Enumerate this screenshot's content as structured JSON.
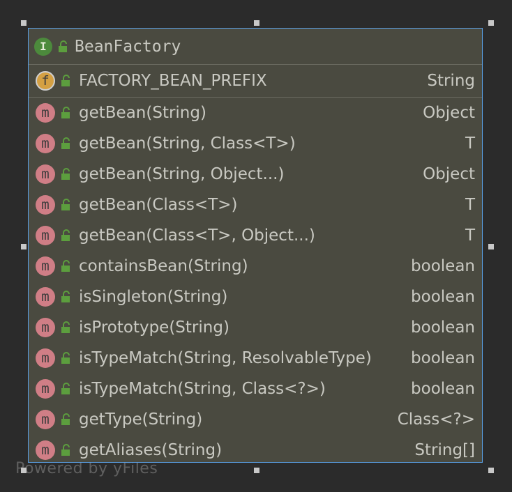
{
  "node": {
    "title": "BeanFactory",
    "class_badge": "I",
    "field": {
      "badge": "f",
      "name": "FACTORY_BEAN_PREFIX",
      "type": "String"
    },
    "methods": [
      {
        "badge": "m",
        "name": "getBean(String)",
        "type": "Object"
      },
      {
        "badge": "m",
        "name": "getBean(String, Class<T>)",
        "type": "T"
      },
      {
        "badge": "m",
        "name": "getBean(String, Object...)",
        "type": "Object"
      },
      {
        "badge": "m",
        "name": "getBean(Class<T>)",
        "type": "T"
      },
      {
        "badge": "m",
        "name": "getBean(Class<T>, Object...)",
        "type": "T"
      },
      {
        "badge": "m",
        "name": "containsBean(String)",
        "type": "boolean"
      },
      {
        "badge": "m",
        "name": "isSingleton(String)",
        "type": "boolean"
      },
      {
        "badge": "m",
        "name": "isPrototype(String)",
        "type": "boolean"
      },
      {
        "badge": "m",
        "name": "isTypeMatch(String, ResolvableType)",
        "type": "boolean"
      },
      {
        "badge": "m",
        "name": "isTypeMatch(String, Class<?>)",
        "type": "boolean"
      },
      {
        "badge": "m",
        "name": "getType(String)",
        "type": "Class<?>"
      },
      {
        "badge": "m",
        "name": "getAliases(String)",
        "type": "String[]"
      }
    ]
  },
  "watermark": "Powered by yFiles",
  "colors": {
    "background": "#2b2b2b",
    "node_fill": "#4a4a40",
    "selection_border": "#5aa0e6",
    "interface_badge": "#4c8a3c",
    "field_badge": "#d4a043",
    "method_badge": "#d07e86",
    "lock_icon": "#5c9e3e"
  }
}
